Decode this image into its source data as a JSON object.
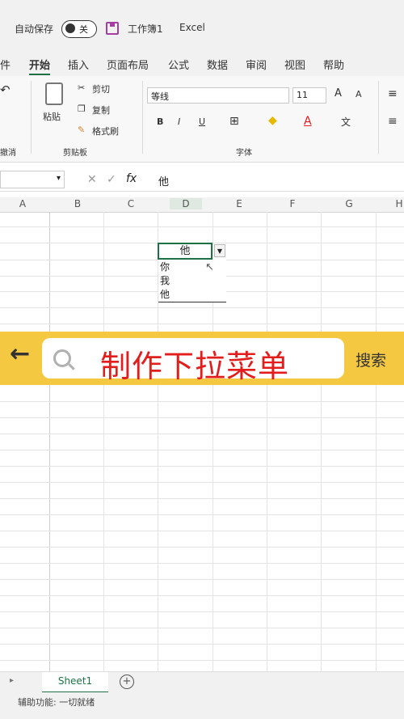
{
  "titlebar": {
    "autosave_label": "自动保存",
    "toggle_state": "关",
    "doc_name": "工作簿1",
    "app_name": "Excel"
  },
  "tabs": [
    "件",
    "开始",
    "插入",
    "页面布局",
    "公式",
    "数据",
    "审阅",
    "视图",
    "帮助"
  ],
  "active_tab": "开始",
  "ribbon": {
    "clipboard": {
      "paste_label": "粘贴",
      "cut_label": "剪切",
      "copy_label": "复制",
      "format_painter_label": "格式刷",
      "group_label": "剪贴板"
    },
    "font": {
      "font_name": "等线",
      "font_size": "11",
      "bold": "B",
      "italic": "I",
      "underline": "U",
      "grow_label": "A",
      "shrink_label": "A",
      "group_label": "字体"
    },
    "left_group_label": "撤消"
  },
  "formula_bar": {
    "fx_label": "fx",
    "value": "他"
  },
  "columns": [
    "A",
    "B",
    "C",
    "D",
    "E",
    "F",
    "G",
    "H"
  ],
  "active_cell_value": "他",
  "dropdown_options": [
    "你",
    "我",
    "他"
  ],
  "banner": {
    "search_text": "制作下拉菜单",
    "search_button": "搜索"
  },
  "sheet": {
    "tab_name": "Sheet1",
    "add_label": "+"
  },
  "status": {
    "text": "辅助功能: 一切就绪"
  },
  "colors": {
    "accent": "#1e7145",
    "banner": "#f5c842",
    "search_text": "#e31c1c"
  }
}
